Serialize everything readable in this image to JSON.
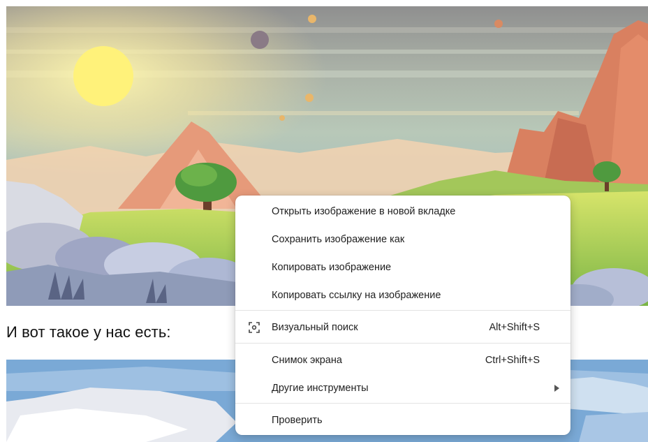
{
  "page": {
    "caption": "И вот такое у нас есть:"
  },
  "colors": {
    "sky_top": "#9a9a9a",
    "sky_mid": "#b9c6b6",
    "sun": "#fff27a",
    "mountain": "#e79a78",
    "grass": "#a9d35a",
    "menu_bg": "#ffffff",
    "menu_text": "#1f1f1f",
    "separator": "#e3e3e3"
  },
  "context_menu": {
    "open_in_new_tab": "Открыть изображение в новой вкладке",
    "save_image_as": "Сохранить изображение как",
    "copy_image": "Копировать изображение",
    "copy_image_link": "Копировать ссылку на изображение",
    "visual_search": "Визуальный поиск",
    "visual_search_shortcut": "Alt+Shift+S",
    "screenshot": "Снимок экрана",
    "screenshot_shortcut": "Ctrl+Shift+S",
    "more_tools": "Другие инструменты",
    "inspect": "Проверить"
  },
  "icons": {
    "visual_search": "visual-search-icon",
    "more_tools_submenu": "chevron-right-icon"
  }
}
